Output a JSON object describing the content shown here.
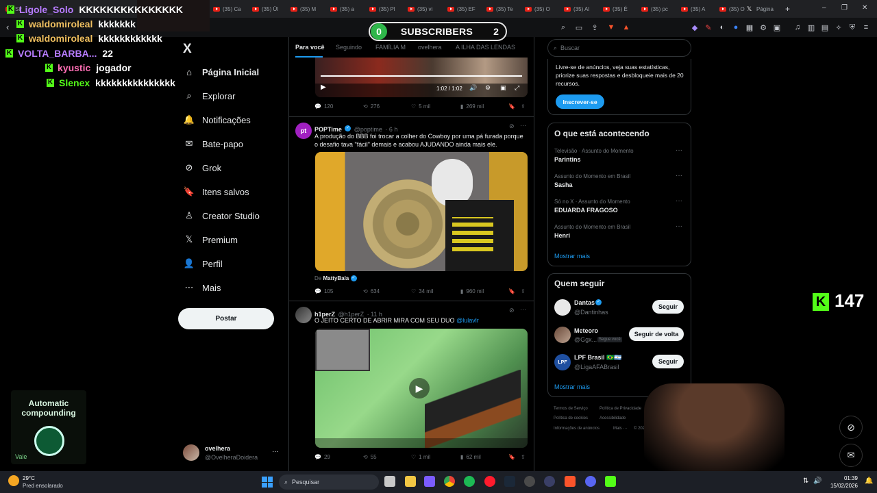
{
  "browser": {
    "tabs": [
      {
        "label": "Str"
      },
      {
        "label": "(35) Ca"
      },
      {
        "label": "(35) Ül"
      },
      {
        "label": "(35) M"
      },
      {
        "label": "(35) a"
      },
      {
        "label": "(35) Pl"
      },
      {
        "label": "(35) vi"
      },
      {
        "label": "(35) EF"
      },
      {
        "label": "(35) Te"
      },
      {
        "label": "(35) O"
      },
      {
        "label": "(35) Al"
      },
      {
        "label": "(35) É"
      },
      {
        "label": "(35) pc"
      },
      {
        "label": "(35) A"
      },
      {
        "label": "(35) O"
      },
      {
        "label": "Página"
      }
    ],
    "new_tab": "+",
    "window_controls": [
      "–",
      "❐",
      "✕"
    ]
  },
  "stream": {
    "chat": [
      {
        "user": "Ligole_Solo",
        "msg": "KKKKKKKKKKKKKKK",
        "color": "#b77cff"
      },
      {
        "user": "waldomiroleal",
        "msg": "kkkkkkk",
        "color": "#f0c060"
      },
      {
        "user": "waldomiroleal",
        "msg": "kkkkkkkkkkkk",
        "color": "#f0c060"
      },
      {
        "user": "VOLTA_BARBA...",
        "msg": "22",
        "color": "#b77cff"
      },
      {
        "user": "kyustic",
        "msg": "jogador",
        "color": "#ff6fb5"
      },
      {
        "user": "Slenex",
        "msg": "kkkkkkkkkkkkkkk",
        "color": "#53fc18"
      }
    ],
    "subscribers_label": "SUBSCRIBERS",
    "subscribers_left": "0",
    "subscribers_right": "2",
    "viewer_count": "147",
    "kick_logo": "K",
    "promo_line1": "Automatic",
    "promo_line2": "compounding",
    "promo_brand": "Vale"
  },
  "nav": {
    "logo": "X",
    "items": [
      {
        "label": "Página Inicial",
        "icon": "home-icon",
        "glyph": "⌂"
      },
      {
        "label": "Explorar",
        "icon": "search-icon",
        "glyph": "⌕"
      },
      {
        "label": "Notificações",
        "icon": "bell-icon",
        "glyph": "🔔"
      },
      {
        "label": "Bate-papo",
        "icon": "mail-icon",
        "glyph": "✉"
      },
      {
        "label": "Grok",
        "icon": "grok-icon",
        "glyph": "⊘"
      },
      {
        "label": "Itens salvos",
        "icon": "bookmark-icon",
        "glyph": "🔖"
      },
      {
        "label": "Creator Studio",
        "icon": "creator-icon",
        "glyph": "♙"
      },
      {
        "label": "Premium",
        "icon": "x-premium-icon",
        "glyph": "𝕏"
      },
      {
        "label": "Perfil",
        "icon": "profile-icon",
        "glyph": "👤"
      },
      {
        "label": "Mais",
        "icon": "more-icon",
        "glyph": "⋯"
      }
    ],
    "post_button": "Postar",
    "account_name": "ovelhera",
    "account_handle": "@OvelheraDoidera"
  },
  "feed": {
    "tabs": [
      "Para você",
      "Seguindo",
      "FAMÍLIA M",
      "ovelhera",
      "A ILHA DAS LENDAS"
    ],
    "first_video": {
      "time": "1:02 / 1:02",
      "replies": "120",
      "reposts": "276",
      "likes": "5 mil",
      "views": "269 mil"
    },
    "posts": [
      {
        "name": "POPTime",
        "handle": "@poptime",
        "time": "· 6 h",
        "text": "A produção do BBB foi trocar a colher do Cowboy por uma pá furada porque o desafio tava \"fácil\" demais e acabou AJUDANDO ainda mais ele.",
        "from_label": "De",
        "from_name": "MattyBala",
        "replies": "105",
        "reposts": "634",
        "likes": "34 mil",
        "views": "960 mil"
      },
      {
        "name": "h1perZ",
        "handle": "@h1perZ",
        "time": "· 11 h",
        "text": "O JEITO CERTO DE ABRIR MIRA COM SEU DUO",
        "mention": "@lulavlr",
        "replies": "29",
        "reposts": "55",
        "likes": "1 mil",
        "views": "62 mil"
      }
    ]
  },
  "right": {
    "search_placeholder": "Buscar",
    "premium_text": "Livre-se de anúncios, veja suas estatísticas, priorize suas respostas e desbloqueie mais de 20 recursos.",
    "subscribe_button": "Inscrever-se",
    "trends_title": "O que está acontecendo",
    "trends": [
      {
        "context": "Televisão · Assunto do Momento",
        "name": "Parintins"
      },
      {
        "context": "Assunto do Momento em Brasil",
        "name": "Sasha"
      },
      {
        "context": "Só no X · Assunto do Momento",
        "name": "EDUARDA FRAGOSO"
      },
      {
        "context": "Assunto do Momento em Brasil",
        "name": "Henri"
      }
    ],
    "show_more": "Mostrar mais",
    "who_to_follow_title": "Quem seguir",
    "follows": [
      {
        "name": "Dantas",
        "handle": "@Dantinhas",
        "button": "Seguir"
      },
      {
        "name": "Meteoro",
        "handle": "@Ggx...",
        "badge": "Segue você",
        "button": "Seguir de volta"
      },
      {
        "name": "LPF Brasil 🇧🇷🇦🇷",
        "handle": "@LigaAFABrasil",
        "button": "Seguir"
      }
    ],
    "show_more_2": "Mostrar mais",
    "footer": [
      "Termos de Serviço",
      "Política de Privacidade",
      "Política de cookies",
      "Acessibilidade",
      "Informações de anúncios",
      "Mais ···",
      "© 2026 X Corp."
    ]
  },
  "taskbar": {
    "weather_temp": "29°C",
    "weather_desc": "Pred ensolarado",
    "search_placeholder": "Pesquisar",
    "time": "01:39",
    "date": "15/02/2026"
  },
  "colors": {
    "accent": "#1d9bf0",
    "kick": "#53fc18",
    "background": "#000000"
  }
}
